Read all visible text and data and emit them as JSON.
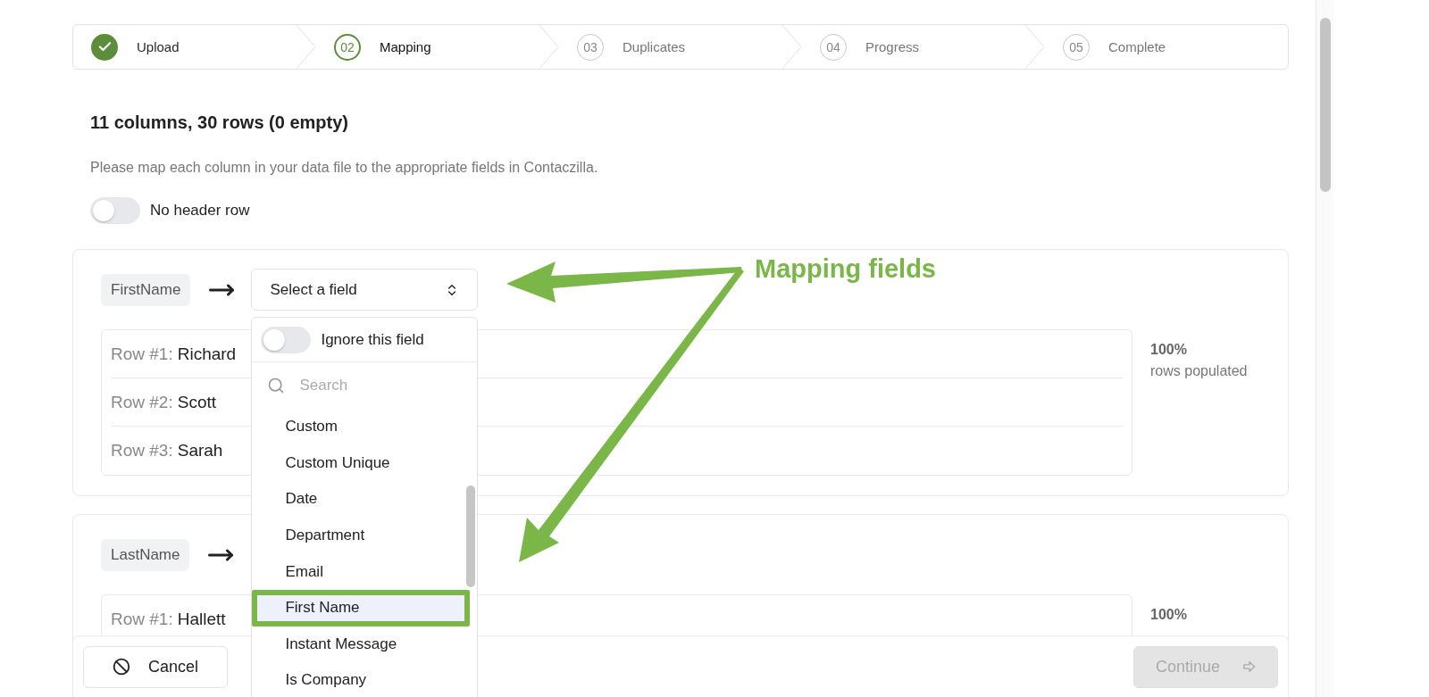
{
  "steps": [
    {
      "label": "Upload",
      "completed": true,
      "selected": false
    },
    {
      "number": "02",
      "label": "Mapping",
      "completed": false,
      "selected": true
    },
    {
      "number": "03",
      "label": "Duplicates",
      "completed": false,
      "selected": false
    },
    {
      "number": "04",
      "label": "Progress",
      "completed": false,
      "selected": false
    },
    {
      "number": "05",
      "label": "Complete",
      "completed": false,
      "selected": false
    }
  ],
  "summary": "11 columns, 30 rows (0 empty)",
  "instructions": "Please map each column in your data file to the appropriate fields in Contaczilla.",
  "no_header_toggle": {
    "label": "No header row",
    "on": false
  },
  "mappings": [
    {
      "column": "FirstName",
      "select_placeholder": "Select a field",
      "open": true,
      "rows": [
        {
          "label": "Row #1:",
          "value": "Richard"
        },
        {
          "label": "Row #2:",
          "value": "Scott"
        },
        {
          "label": "Row #3:",
          "value": "Sarah"
        }
      ],
      "percent": "100%",
      "caption": "rows populated"
    },
    {
      "column": "LastName",
      "rows": [
        {
          "label": "Row #1:",
          "value": "Hallett"
        }
      ],
      "percent": "100%"
    }
  ],
  "field_dropdown": {
    "ignore_toggle": {
      "label": "Ignore this field",
      "on": false
    },
    "search_placeholder": "Search",
    "options": [
      {
        "label": "Custom",
        "selected": false
      },
      {
        "label": "Custom Unique",
        "selected": false
      },
      {
        "label": "Date",
        "selected": false
      },
      {
        "label": "Department",
        "selected": false
      },
      {
        "label": "Email",
        "selected": false
      },
      {
        "label": "First Name",
        "selected": true
      },
      {
        "label": "Instant Message",
        "selected": false
      },
      {
        "label": "Is Company",
        "selected": false
      }
    ]
  },
  "footer": {
    "cancel": "Cancel",
    "continue": {
      "label": "Continue",
      "disabled": true
    }
  },
  "annotation": {
    "text": "Mapping fields"
  }
}
